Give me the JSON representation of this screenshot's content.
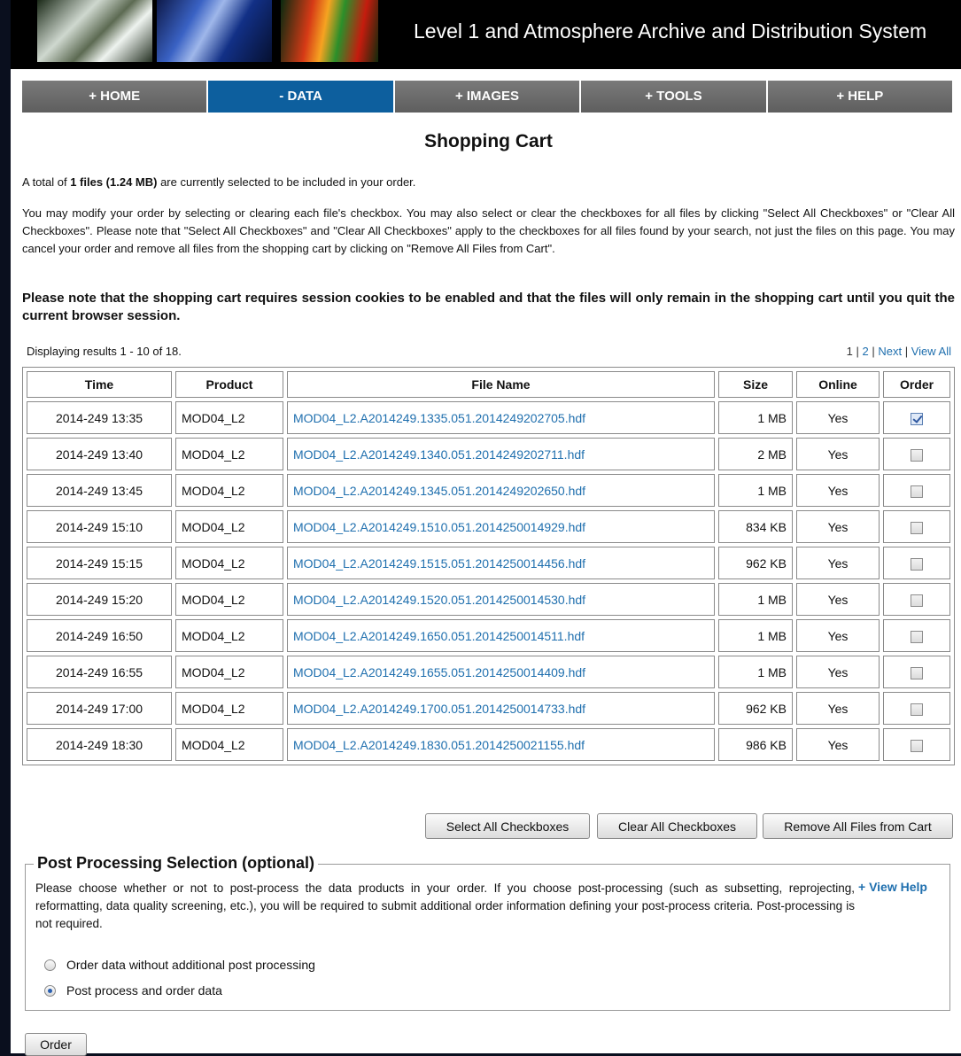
{
  "banner": {
    "title": "Level 1 and Atmosphere Archive and Distribution System"
  },
  "nav": [
    {
      "label": "+ HOME",
      "active": false
    },
    {
      "label": "- DATA",
      "active": true
    },
    {
      "label": "+ IMAGES",
      "active": false
    },
    {
      "label": "+ TOOLS",
      "active": false
    },
    {
      "label": "+ HELP",
      "active": false
    }
  ],
  "page_title": "Shopping Cart",
  "summary": {
    "prefix": "A total of ",
    "count": "1 files (1.24 MB)",
    "suffix": " are currently selected to be included in your order."
  },
  "instructions": "You may modify your order by selecting or clearing each file's checkbox. You may also select or clear the checkboxes for all files by clicking \"Select All Checkboxes\" or \"Clear All Checkboxes\". Please note that \"Select All Checkboxes\" and \"Clear All Checkboxes\" apply to the checkboxes for all files found by your search, not just the files on this page. You may cancel your order and remove all files from the shopping cart by clicking on \"Remove All Files from Cart\".",
  "note": "Please note that the shopping cart requires session cookies to be enabled and that the files will only remain in the shopping cart until you quit the current browser session.",
  "results_info": "Displaying results 1 - 10 of 18.",
  "pager": {
    "page1": "1",
    "sep": " | ",
    "page2": "2",
    "next": "Next",
    "view_all": "View All"
  },
  "table": {
    "headers": {
      "time": "Time",
      "product": "Product",
      "file": "File Name",
      "size": "Size",
      "online": "Online",
      "order": "Order"
    },
    "rows": [
      {
        "time": "2014-249 13:35",
        "product": "MOD04_L2",
        "file": "MOD04_L2.A2014249.1335.051.2014249202705.hdf",
        "size": "1 MB",
        "online": "Yes",
        "checked": true
      },
      {
        "time": "2014-249 13:40",
        "product": "MOD04_L2",
        "file": "MOD04_L2.A2014249.1340.051.2014249202711.hdf",
        "size": "2 MB",
        "online": "Yes",
        "checked": false
      },
      {
        "time": "2014-249 13:45",
        "product": "MOD04_L2",
        "file": "MOD04_L2.A2014249.1345.051.2014249202650.hdf",
        "size": "1 MB",
        "online": "Yes",
        "checked": false
      },
      {
        "time": "2014-249 15:10",
        "product": "MOD04_L2",
        "file": "MOD04_L2.A2014249.1510.051.2014250014929.hdf",
        "size": "834 KB",
        "online": "Yes",
        "checked": false
      },
      {
        "time": "2014-249 15:15",
        "product": "MOD04_L2",
        "file": "MOD04_L2.A2014249.1515.051.2014250014456.hdf",
        "size": "962 KB",
        "online": "Yes",
        "checked": false
      },
      {
        "time": "2014-249 15:20",
        "product": "MOD04_L2",
        "file": "MOD04_L2.A2014249.1520.051.2014250014530.hdf",
        "size": "1 MB",
        "online": "Yes",
        "checked": false
      },
      {
        "time": "2014-249 16:50",
        "product": "MOD04_L2",
        "file": "MOD04_L2.A2014249.1650.051.2014250014511.hdf",
        "size": "1 MB",
        "online": "Yes",
        "checked": false
      },
      {
        "time": "2014-249 16:55",
        "product": "MOD04_L2",
        "file": "MOD04_L2.A2014249.1655.051.2014250014409.hdf",
        "size": "1 MB",
        "online": "Yes",
        "checked": false
      },
      {
        "time": "2014-249 17:00",
        "product": "MOD04_L2",
        "file": "MOD04_L2.A2014249.1700.051.2014250014733.hdf",
        "size": "962 KB",
        "online": "Yes",
        "checked": false
      },
      {
        "time": "2014-249 18:30",
        "product": "MOD04_L2",
        "file": "MOD04_L2.A2014249.1830.051.2014250021155.hdf",
        "size": "986 KB",
        "online": "Yes",
        "checked": false
      }
    ]
  },
  "buttons": {
    "select_all": "Select All Checkboxes",
    "clear_all": "Clear All Checkboxes",
    "remove_all": "Remove All Files from Cart",
    "order": "Order"
  },
  "post_processing": {
    "legend": "Post Processing Selection (optional)",
    "text": "Please choose whether or not to post-process the data products in your order. If you choose post-processing (such as subsetting, reprojecting, reformatting, data quality screening, etc.), you will be required to submit additional order information defining your post-process criteria. Post-processing is not required.",
    "help_link": "+ View Help",
    "options": [
      {
        "label": "Order data without additional post processing",
        "selected": false
      },
      {
        "label": "Post process and order data",
        "selected": true
      }
    ]
  },
  "colors": {
    "nav_active": "#0d5f9e",
    "nav_inactive": "#6b6b6b",
    "link": "#1f6fae",
    "outer_background": "#0a0f1e"
  }
}
